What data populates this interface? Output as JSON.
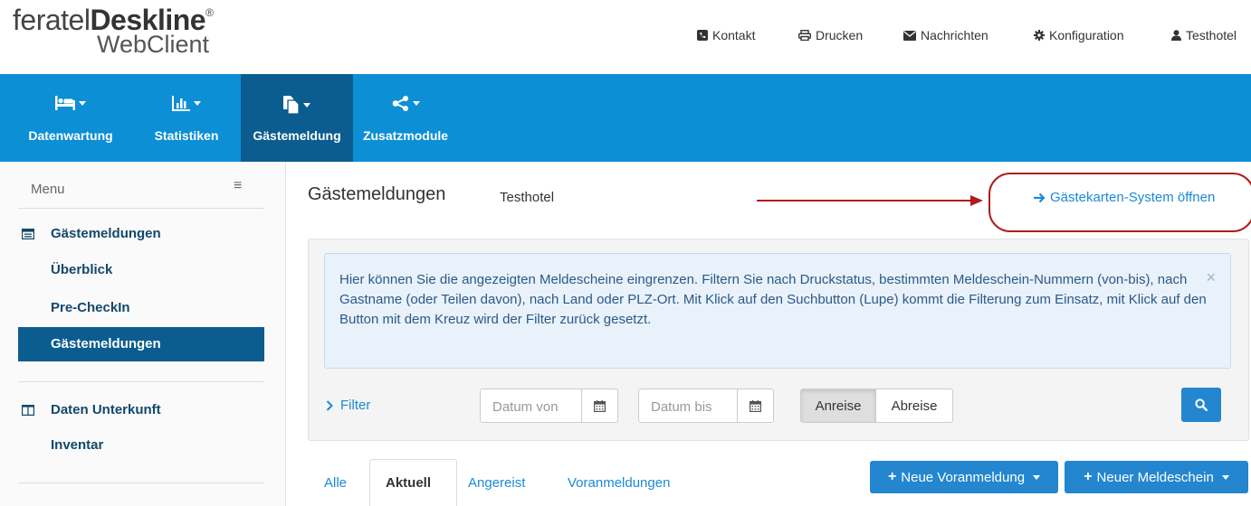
{
  "logo": {
    "brand_light": "feratel",
    "brand_bold": "Deskline",
    "reg": "®",
    "sub": "WebClient"
  },
  "topnav": [
    {
      "label": "Kontakt",
      "icon": "phone-icon"
    },
    {
      "label": "Drucken",
      "icon": "printer-icon"
    },
    {
      "label": "Nachrichten",
      "icon": "envelope-icon"
    },
    {
      "label": "Konfiguration",
      "icon": "gear-icon"
    },
    {
      "label": "Testhotel",
      "icon": "user-icon"
    }
  ],
  "mainnav": [
    {
      "label": "Datenwartung",
      "icon": "bed-icon"
    },
    {
      "label": "Statistiken",
      "icon": "bar-chart-icon"
    },
    {
      "label": "Gästemeldung",
      "icon": "documents-icon",
      "active": true
    },
    {
      "label": "Zusatzmodule",
      "icon": "share-icon"
    }
  ],
  "sidebar": {
    "menu_label": "Menu",
    "section1": "Gästemeldungen",
    "items": [
      "Überblick",
      "Pre-CheckIn",
      "Gästemeldungen"
    ],
    "section2": "Daten Unterkunft",
    "items2": [
      "Inventar"
    ]
  },
  "page": {
    "title": "Gästemeldungen",
    "subtitle": "Testhotel",
    "action_link": "Gästekarten-System öffnen"
  },
  "info": {
    "text": "Hier können Sie die angezeigten Meldescheine eingrenzen. Filtern Sie nach Druckstatus, bestimmten Meldeschein-Nummern (von-bis), nach Gastname (oder Teilen davon), nach Land oder PLZ-Ort. Mit Klick auf den Suchbutton (Lupe) kommt die Filterung zum Einsatz, mit Klick auf den Button mit dem Kreuz wird der Filter zurück gesetzt.",
    "close": "×"
  },
  "filter": {
    "label": "Filter",
    "date_from_placeholder": "Datum von",
    "date_to_placeholder": "Datum bis",
    "seg_anreise": "Anreise",
    "seg_abreise": "Abreise"
  },
  "tabs": [
    "Alle",
    "Aktuell",
    "Angereist",
    "Voranmeldungen"
  ],
  "buttons": {
    "new_prereg": "Neue Voranmeldung",
    "new_form": "Neuer Meldeschein"
  },
  "colors": {
    "nav_blue": "#0c8fd4",
    "nav_active": "#0b5d8f",
    "link": "#1a8ad6",
    "annotation": "#b01c1c"
  }
}
